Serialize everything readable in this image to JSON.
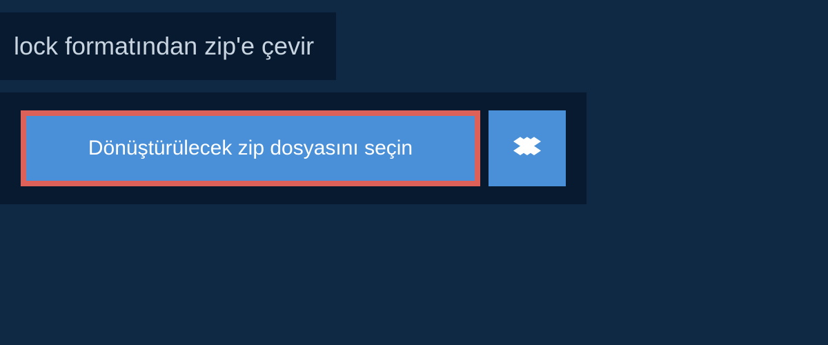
{
  "header": {
    "title": "lock formatından zip'e çevir"
  },
  "upload": {
    "select_label": "Dönüştürülecek zip dosyasını seçin"
  },
  "colors": {
    "background": "#0f2844",
    "panel": "#081a30",
    "button": "#4990d9",
    "highlight_border": "#de6159",
    "text_light": "#c8d4e0",
    "text_white": "#ffffff"
  }
}
